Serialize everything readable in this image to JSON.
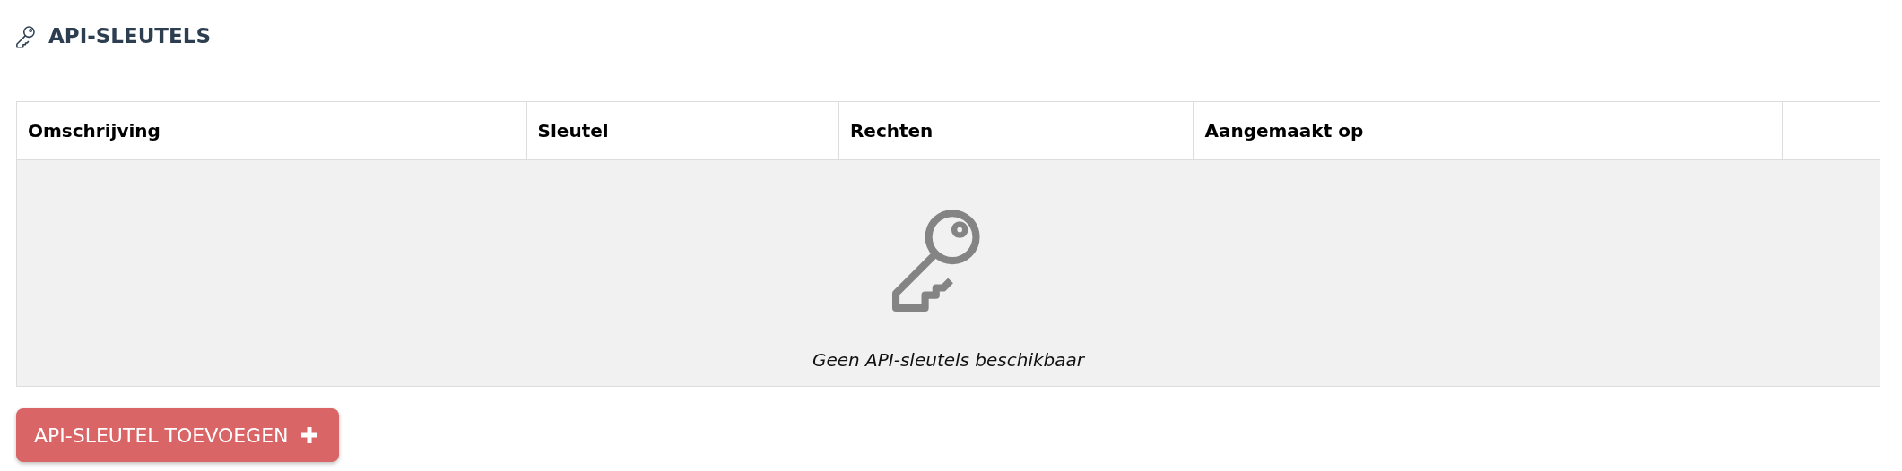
{
  "heading": {
    "title": "API-SLEUTELS"
  },
  "table": {
    "columns": [
      "Omschrijving",
      "Sleutel",
      "Rechten",
      "Aangemaakt op",
      ""
    ],
    "empty_message": "Geen API-sleutels beschikbaar"
  },
  "buttons": [
    {
      "label": "API-SLEUTEL TOEVOEGEN",
      "kind": "add"
    }
  ]
}
